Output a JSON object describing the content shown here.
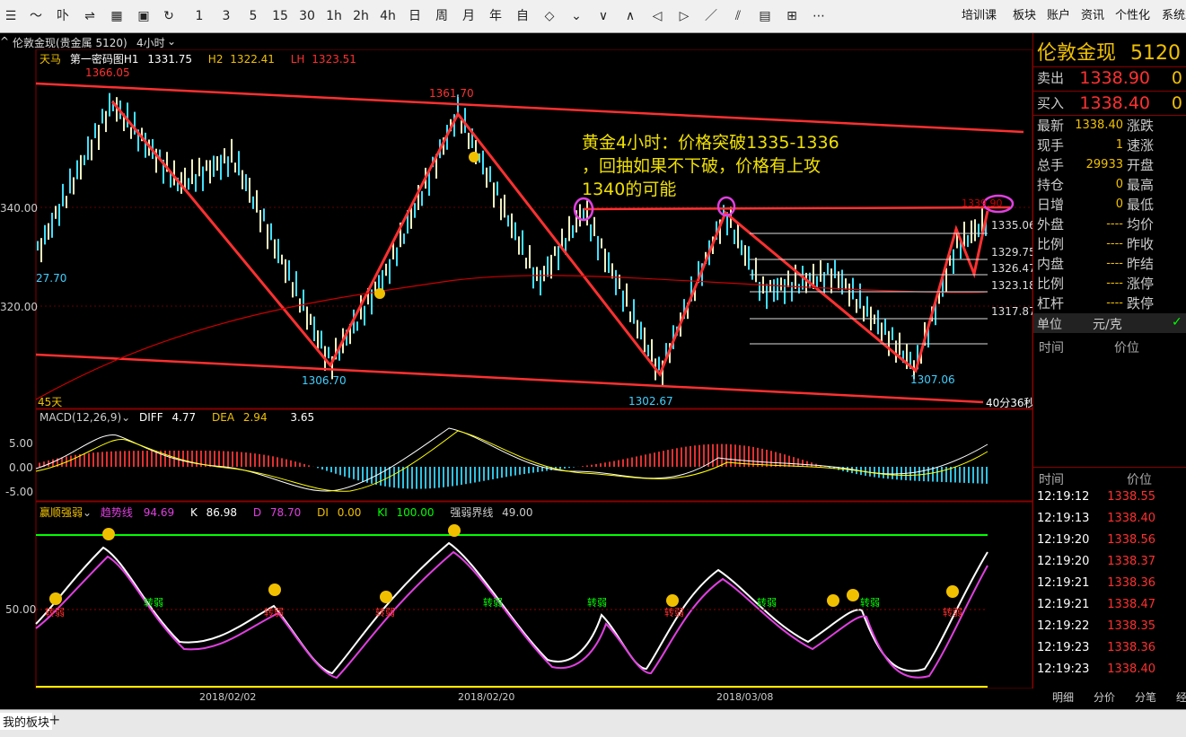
{
  "toolbar": {
    "icons": [
      "list-icon",
      "chart-icon",
      "candle-icon",
      "adjust-icon",
      "grid-icon",
      "save-icon",
      "refresh-icon"
    ],
    "periods": [
      "1",
      "3",
      "5",
      "15",
      "30",
      "1h",
      "2h",
      "4h",
      "日",
      "周",
      "月",
      "年",
      "自"
    ],
    "menus": [
      "培训课",
      "板块",
      "账户",
      "资讯",
      "个性化",
      "系统工"
    ]
  },
  "title": {
    "instrument": "伦敦金现(贵金属 5120)",
    "period": "4小时"
  },
  "indicator_header": {
    "name": "天马",
    "sub": "第一密码图H1",
    "v1": "1331.75",
    "h2_label": "H2",
    "h2": "1322.41",
    "lh_label": "LH",
    "lh": "1323.51"
  },
  "price_labels": {
    "p1366": "1366.05",
    "p1361": "1361.70",
    "p1306": "1306.70",
    "p1302": "1302.67",
    "p1307": "1307.06",
    "p1335": "1335.06",
    "p1329": "1329.75",
    "p1326": "1326.47",
    "p1323": "1323.18",
    "p1317": "1317.87",
    "p1339": "1339.90",
    "left_2770": "27.70",
    "days": "45天",
    "countdown": "40分36秒"
  },
  "y_axis": {
    "t340": "340.00",
    "t320": "320.00"
  },
  "annotation": {
    "line1": "黄金4小时：价格突破1335-1336",
    "line2": "，回抽如果不下破，价格有上攻",
    "line3": "1340的可能"
  },
  "macd": {
    "name": "MACD(12,26,9)",
    "diff_label": "DIFF",
    "diff": "4.77",
    "dea_label": "DEA",
    "dea": "2.94",
    "macd": "3.65",
    "t5": "5.00",
    "t0": "0.00",
    "tm5": "-5.00"
  },
  "kd": {
    "name": "赢顺强弱",
    "trend_label": "趋势线",
    "trend": "94.69",
    "k_label": "K",
    "k": "86.98",
    "d_label": "D",
    "d": "78.70",
    "di_label": "DI",
    "di": "0.00",
    "ki_label": "KI",
    "ki": "100.00",
    "boundary_label": "强弱界线",
    "boundary": "49.00",
    "t50": "50.00",
    "zr": "转弱"
  },
  "dates": [
    "2018/02/02",
    "2018/02/20",
    "2018/03/08"
  ],
  "right_panel": {
    "title": "伦敦金现",
    "code": "5120",
    "sell_label": "卖出",
    "sell": "1338.90",
    "sell_vol": "0",
    "buy_label": "买入",
    "buy": "1338.40",
    "buy_vol": "0",
    "stats": [
      {
        "l": "最新",
        "v": "1338.40",
        "l2": "涨跌"
      },
      {
        "l": "现手",
        "v": "1",
        "l2": "速涨"
      },
      {
        "l": "总手",
        "v": "29933",
        "l2": "开盘"
      },
      {
        "l": "持仓",
        "v": "0",
        "l2": "最高"
      },
      {
        "l": "日增",
        "v": "0",
        "l2": "最低"
      },
      {
        "l": "外盘",
        "v": "----",
        "l2": "均价"
      },
      {
        "l": "比例",
        "v": "----",
        "l2": "昨收"
      },
      {
        "l": "内盘",
        "v": "----",
        "l2": "昨结"
      },
      {
        "l": "比例",
        "v": "----",
        "l2": "涨停"
      },
      {
        "l": "杠杆",
        "v": "----",
        "l2": "跌停"
      }
    ],
    "unit_label": "单位",
    "unit": "元/克",
    "col_time": "时间",
    "col_price": "价位",
    "ticks": [
      {
        "t": "12:19:12",
        "p": "1338.55"
      },
      {
        "t": "12:19:13",
        "p": "1338.40"
      },
      {
        "t": "12:19:20",
        "p": "1338.56"
      },
      {
        "t": "12:19:20",
        "p": "1338.37"
      },
      {
        "t": "12:19:21",
        "p": "1338.36"
      },
      {
        "t": "12:19:21",
        "p": "1338.47"
      },
      {
        "t": "12:19:22",
        "p": "1338.35"
      },
      {
        "t": "12:19:23",
        "p": "1338.36"
      },
      {
        "t": "12:19:23",
        "p": "1338.40"
      }
    ],
    "tabs": [
      "明细",
      "分价",
      "分笔",
      "经"
    ]
  },
  "bottom": {
    "tab": "我的板块",
    "add": "+"
  }
}
